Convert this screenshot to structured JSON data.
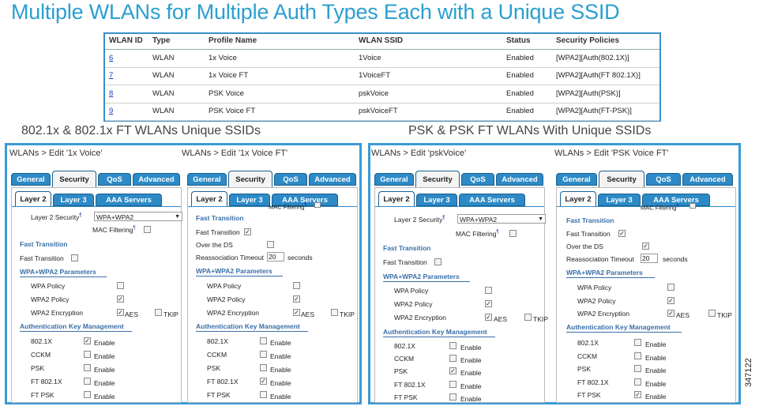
{
  "title": "Multiple WLANs for Multiple Auth Types Each with a Unique SSID",
  "table": {
    "headers": [
      "WLAN ID",
      "Type",
      "Profile Name",
      "WLAN SSID",
      "Status",
      "Security Policies"
    ],
    "rows": [
      {
        "id": "6",
        "type": "WLAN",
        "profile": "1x Voice",
        "ssid": "1Voice",
        "status": "Enabled",
        "policies": "[WPA2][Auth(802.1X)]"
      },
      {
        "id": "7",
        "type": "WLAN",
        "profile": "1x Voice FT",
        "ssid": "1VoiceFT",
        "status": "Enabled",
        "policies": "[WPA2][Auth(FT 802.1X)]"
      },
      {
        "id": "8",
        "type": "WLAN",
        "profile": "PSK Voice",
        "ssid": "pskVoice",
        "status": "Enabled",
        "policies": "[WPA2][Auth(PSK)]"
      },
      {
        "id": "9",
        "type": "WLAN",
        "profile": "PSK Voice FT",
        "ssid": "pskVoiceFT",
        "status": "Enabled",
        "policies": "[WPA2][Auth(FT-PSK)]"
      }
    ]
  },
  "captions": {
    "left": "802.1x & 802.1x FT WLANs Unique SSIDs",
    "right": "PSK & PSK FT WLANs With Unique SSIDs"
  },
  "panels": [
    {
      "header": "WLANs > Edit  '1x Voice'",
      "tabs": [
        "General",
        "Security",
        "QoS",
        "Advanced"
      ],
      "subtabs": [
        "Layer 2",
        "Layer 3",
        "AAA Servers"
      ],
      "l2_security_label": "Layer 2 Security",
      "l2_security_value": "WPA+WPA2",
      "mac_filtering": "MAC Filtering",
      "ft_section": "Fast Transition",
      "fast_transition": "Fast Transition",
      "fast_transition_checked": false,
      "wpa_section": "WPA+WPA2 Parameters",
      "wpa_policy": "WPA Policy",
      "wpa2_policy": "WPA2 Policy",
      "wpa2_encryption": "WPA2 Encryption",
      "aes": "AES",
      "tkip": "TKIP",
      "akm_section": "Authentication Key Management",
      "akm": [
        {
          "name": "802.1X",
          "checked": true
        },
        {
          "name": "CCKM",
          "checked": false
        },
        {
          "name": "PSK",
          "checked": false
        },
        {
          "name": "FT 802.1X",
          "checked": false
        },
        {
          "name": "FT PSK",
          "checked": false
        }
      ],
      "enable": "Enable"
    },
    {
      "header": "WLANs > Edit  '1x Voice FT'",
      "tabs": [
        "General",
        "Security",
        "QoS",
        "Advanced"
      ],
      "subtabs": [
        "Layer 2",
        "Layer 3",
        "AAA Servers"
      ],
      "mac_filtering": "MAC Filtering",
      "ft_section": "Fast Transition",
      "fast_transition": "Fast Transition",
      "over_ds": "Over the DS",
      "reassoc": "Reassociation Timeout",
      "reassoc_value": "20",
      "seconds": "seconds",
      "wpa_section": "WPA+WPA2 Parameters",
      "wpa_policy": "WPA Policy",
      "wpa2_policy": "WPA2 Policy",
      "wpa2_encryption": "WPA2 Encryption",
      "aes": "AES",
      "tkip": "TKIP",
      "akm_section": "Authentication Key Management",
      "akm": [
        {
          "name": "802.1X",
          "checked": false
        },
        {
          "name": "CCKM",
          "checked": false
        },
        {
          "name": "PSK",
          "checked": false
        },
        {
          "name": "FT 802.1X",
          "checked": true
        },
        {
          "name": "FT PSK",
          "checked": false
        }
      ],
      "enable": "Enable"
    },
    {
      "header": "WLANs > Edit  'pskVoice'",
      "tabs": [
        "General",
        "Security",
        "QoS",
        "Advanced"
      ],
      "subtabs": [
        "Layer 2",
        "Layer 3",
        "AAA Servers"
      ],
      "l2_security_label": "Layer 2 Security",
      "l2_security_value": "WPA+WPA2",
      "mac_filtering": "MAC Filtering",
      "ft_section": "Fast Transition",
      "fast_transition": "Fast Transition",
      "fast_transition_checked": false,
      "wpa_section": "WPA+WPA2 Parameters",
      "wpa_policy": "WPA Policy",
      "wpa2_policy": "WPA2 Policy",
      "wpa2_encryption": "WPA2 Encryption",
      "aes": "AES",
      "tkip": "TKIP",
      "akm_section": "Authentication Key Management",
      "akm": [
        {
          "name": "802.1X",
          "checked": false
        },
        {
          "name": "CCKM",
          "checked": false
        },
        {
          "name": "PSK",
          "checked": true
        },
        {
          "name": "FT 802.1X",
          "checked": false
        },
        {
          "name": "FT PSK",
          "checked": false
        }
      ],
      "enable": "Enable"
    },
    {
      "header": "WLANs > Edit  'PSK Voice FT'",
      "tabs": [
        "General",
        "Security",
        "QoS",
        "Advanced"
      ],
      "subtabs": [
        "Layer 2",
        "Layer 3",
        "AAA Servers"
      ],
      "mac_filtering": "MAC Filtering",
      "ft_section": "Fast Transition",
      "fast_transition": "Fast Transition",
      "over_ds": "Over the DS",
      "reassoc": "Reassociation Timeout",
      "reassoc_value": "20",
      "seconds": "seconds",
      "wpa_section": "WPA+WPA2 Parameters",
      "wpa_policy": "WPA Policy",
      "wpa2_policy": "WPA2 Policy",
      "wpa2_encryption": "WPA2 Encryption",
      "aes": "AES",
      "tkip": "TKIP",
      "akm_section": "Authentication Key Management",
      "akm": [
        {
          "name": "802.1X",
          "checked": false
        },
        {
          "name": "CCKM",
          "checked": false
        },
        {
          "name": "PSK",
          "checked": false
        },
        {
          "name": "FT 802.1X",
          "checked": false
        },
        {
          "name": "FT PSK",
          "checked": true
        }
      ],
      "enable": "Enable"
    }
  ],
  "figure_number": "347122",
  "colors": {
    "title": "#2a9fd0",
    "frame": "#3a9ad6",
    "tab": "#2d8ac6",
    "section": "#3a6fa8"
  }
}
